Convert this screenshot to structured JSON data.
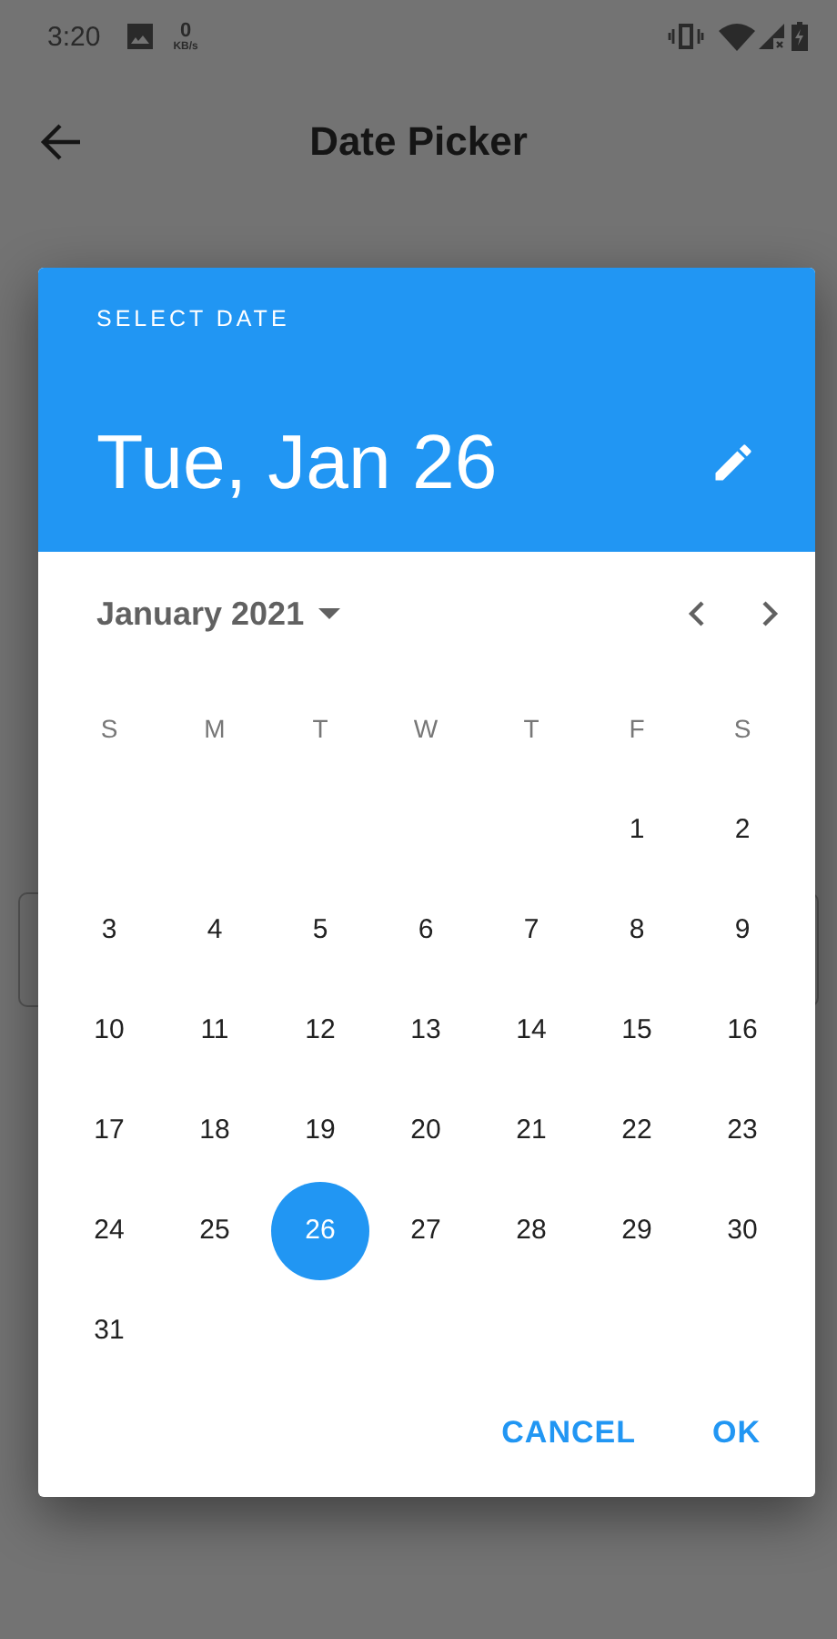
{
  "status_bar": {
    "time": "3:20",
    "speed_value": "0",
    "speed_unit": "KB/s"
  },
  "app_bar": {
    "title": "Date Picker"
  },
  "dialog": {
    "header_label": "SELECT DATE",
    "selected_date": "Tue, Jan 26",
    "month": "January 2021",
    "weekdays": [
      "S",
      "M",
      "T",
      "W",
      "T",
      "F",
      "S"
    ],
    "weeks": [
      [
        {
          "day": "1",
          "selected": false
        },
        {
          "day": "2",
          "selected": false
        }
      ],
      [
        {
          "day": "3",
          "selected": false
        },
        {
          "day": "4",
          "selected": false
        },
        {
          "day": "5",
          "selected": false
        },
        {
          "day": "6",
          "selected": false
        },
        {
          "day": "7",
          "selected": false
        },
        {
          "day": "8",
          "selected": false
        },
        {
          "day": "9",
          "selected": false
        }
      ],
      [
        {
          "day": "10",
          "selected": false
        },
        {
          "day": "11",
          "selected": false
        },
        {
          "day": "12",
          "selected": false
        },
        {
          "day": "13",
          "selected": false
        },
        {
          "day": "14",
          "selected": false
        },
        {
          "day": "15",
          "selected": false
        },
        {
          "day": "16",
          "selected": false
        }
      ],
      [
        {
          "day": "17",
          "selected": false
        },
        {
          "day": "18",
          "selected": false
        },
        {
          "day": "19",
          "selected": false
        },
        {
          "day": "20",
          "selected": false
        },
        {
          "day": "21",
          "selected": false
        },
        {
          "day": "22",
          "selected": false
        },
        {
          "day": "23",
          "selected": false
        }
      ],
      [
        {
          "day": "24",
          "selected": false
        },
        {
          "day": "25",
          "selected": false
        },
        {
          "day": "26",
          "selected": true
        },
        {
          "day": "27",
          "selected": false
        },
        {
          "day": "28",
          "selected": false
        },
        {
          "day": "29",
          "selected": false
        },
        {
          "day": "30",
          "selected": false
        }
      ],
      [
        {
          "day": "31",
          "selected": false
        }
      ]
    ],
    "buttons": [
      "CANCEL",
      "OK"
    ]
  }
}
